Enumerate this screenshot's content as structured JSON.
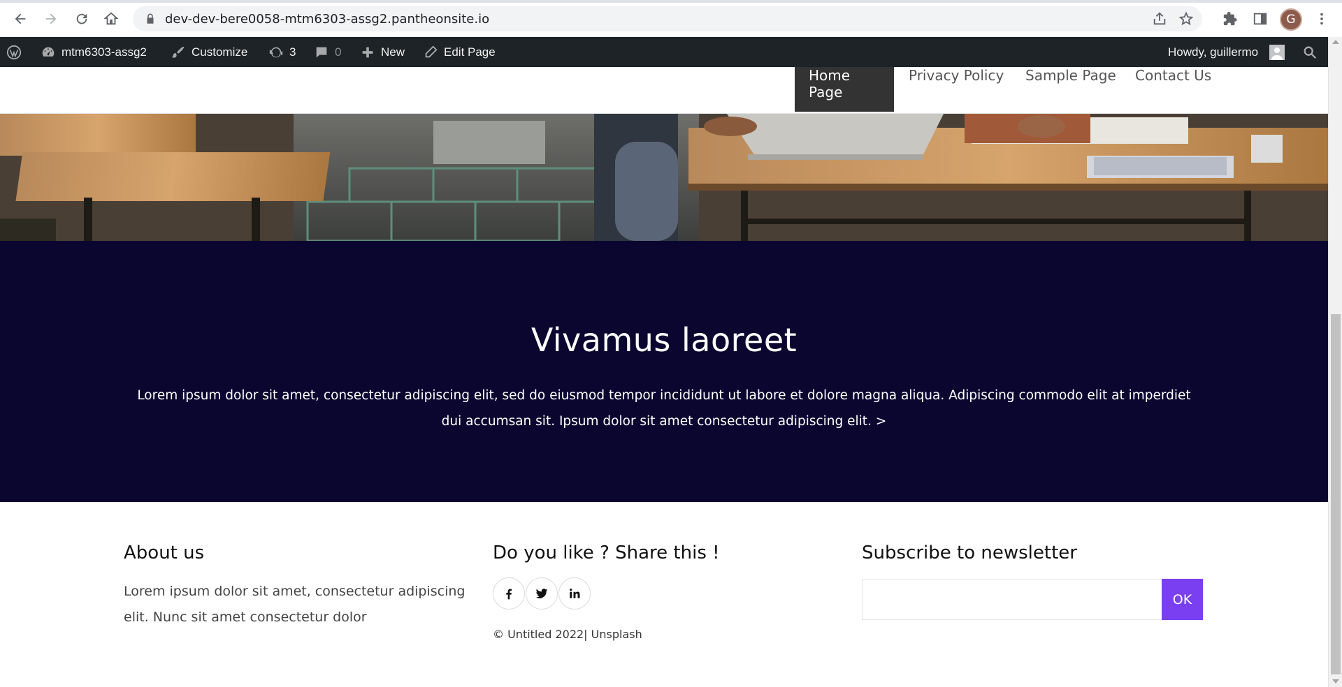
{
  "browser": {
    "url": "dev-dev-bere0058-mtm6303-assg2.pantheonsite.io",
    "profile_initial": "G",
    "icons": [
      "back-icon",
      "forward-icon",
      "reload-icon",
      "home-icon",
      "lock-icon",
      "share-icon",
      "star-icon",
      "extensions-icon",
      "side-panel-icon",
      "kebab-menu-icon"
    ]
  },
  "admin_bar": {
    "site_name": "mtm6303-assg2",
    "customize": "Customize",
    "updates_count": "3",
    "comments_count": "0",
    "new_label": "New",
    "edit_page": "Edit Page",
    "howdy": "Howdy, guillermo"
  },
  "nav": {
    "items": [
      {
        "label": "Home Page",
        "active": true
      },
      {
        "label": "Privacy Policy",
        "active": false
      },
      {
        "label": "Sample Page",
        "active": false
      },
      {
        "label": "Contact Us",
        "active": false
      }
    ]
  },
  "band": {
    "title": "Vivamus laoreet",
    "text": "Lorem ipsum dolor sit amet, consectetur adipiscing elit, sed do eiusmod tempor incididunt ut labore et dolore magna aliqua. Adipiscing commodo elit at imperdiet dui accumsan sit. Ipsum dolor sit amet consectetur adipiscing elit. >",
    "bg_color": "#0b0630"
  },
  "footer": {
    "about_title": "About us",
    "about_text": "Lorem ipsum dolor sit amet, consectetur adipiscing elit. Nunc sit amet consectetur dolor",
    "share_title": "Do you like ? Share this !",
    "social": [
      "f",
      "twitter",
      "in"
    ],
    "copyright": "© Untitled 2022| Unsplash",
    "newsletter_title": "Subscribe to newsletter",
    "newsletter_placeholder": "",
    "ok_label": "OK",
    "accent": "#7b3ff2"
  }
}
